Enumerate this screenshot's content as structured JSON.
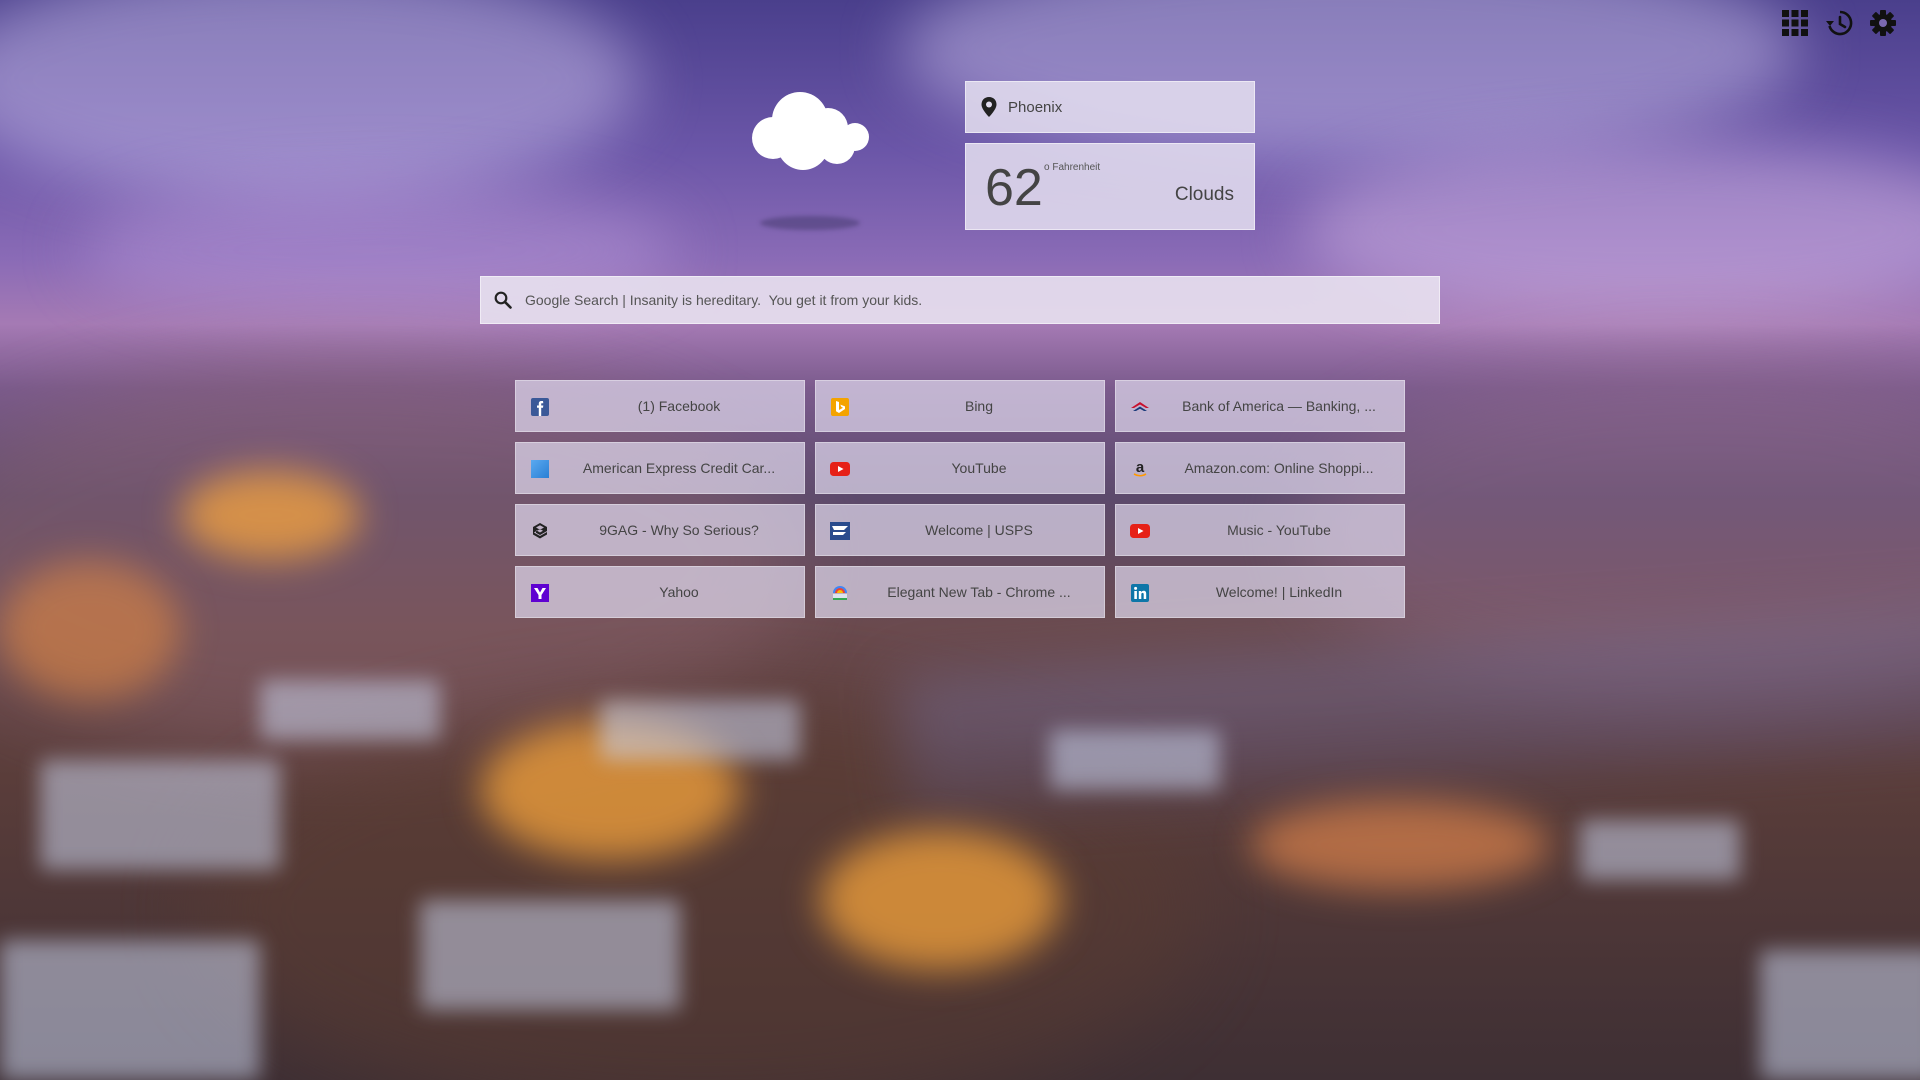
{
  "toolbar": {
    "apps_icon": "grid-icon",
    "history_icon": "history-icon",
    "settings_icon": "gear-icon"
  },
  "weather": {
    "icon": "cloud-icon",
    "location": "Phoenix",
    "temperature": "62",
    "unit": "o Fahrenheit",
    "condition": "Clouds"
  },
  "search": {
    "placeholder": "Google Search | Insanity is hereditary.  You get it from your kids."
  },
  "tiles": [
    {
      "label": "(1) Facebook",
      "icon": "facebook-icon",
      "color": "#3b5998"
    },
    {
      "label": "Bing",
      "icon": "bing-icon",
      "color": "#f4a300"
    },
    {
      "label": "Bank of America — Banking, ...",
      "icon": "bank-of-america-icon",
      "color": "#c8102e"
    },
    {
      "label": "American Express Credit Car...",
      "icon": "american-express-icon",
      "color": "#2a7fd4"
    },
    {
      "label": "YouTube",
      "icon": "youtube-icon",
      "color": "#e62117"
    },
    {
      "label": "Amazon.com: Online Shoppi...",
      "icon": "amazon-icon",
      "color": "#222222"
    },
    {
      "label": "9GAG - Why So Serious?",
      "icon": "9gag-icon",
      "color": "#222222"
    },
    {
      "label": "Welcome | USPS",
      "icon": "usps-icon",
      "color": "#2a4b8d"
    },
    {
      "label": "Music - YouTube",
      "icon": "youtube-icon",
      "color": "#e62117"
    },
    {
      "label": "Yahoo",
      "icon": "yahoo-icon",
      "color": "#5f01d1"
    },
    {
      "label": "Elegant New Tab - Chrome ...",
      "icon": "chrome-webstore-icon",
      "color": "#4285f4"
    },
    {
      "label": "Welcome! | LinkedIn",
      "icon": "linkedin-icon",
      "color": "#0e76a8"
    }
  ]
}
